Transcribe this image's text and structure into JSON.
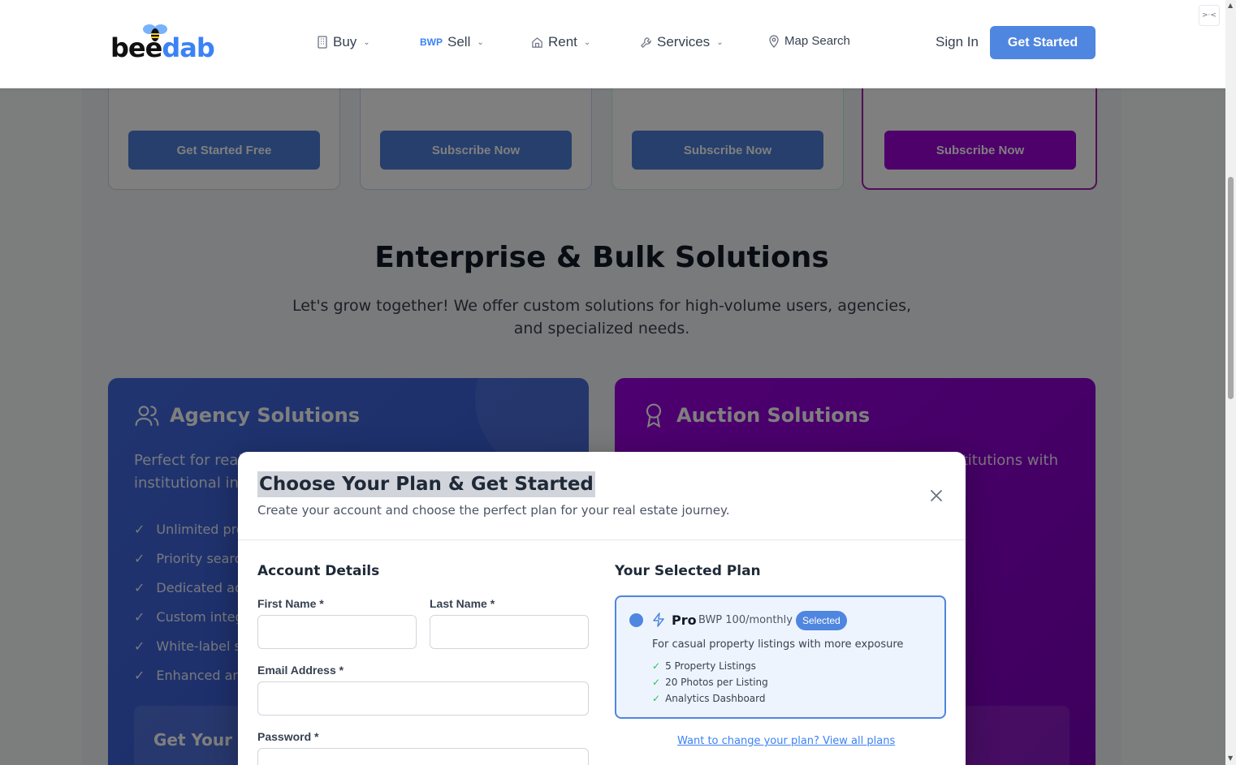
{
  "header": {
    "logo": {
      "part1": "bee",
      "part2": "dab"
    },
    "nav": [
      {
        "label": "Buy",
        "icon": "building-icon"
      },
      {
        "label": "Sell",
        "prefix": "BWP"
      },
      {
        "label": "Rent",
        "icon": "home-icon"
      },
      {
        "label": "Services",
        "icon": "wrench-icon"
      },
      {
        "label": "Map Search",
        "icon": "map-pin-icon"
      }
    ],
    "sign_in": "Sign In",
    "get_started": "Get Started"
  },
  "plans": [
    {
      "button": "Get Started Free"
    },
    {
      "button": "Subscribe Now"
    },
    {
      "button": "Subscribe Now"
    },
    {
      "button": "Subscribe Now"
    }
  ],
  "enterprise": {
    "title": "Enterprise & Bulk Solutions",
    "subtitle": "Let's grow together! We offer custom solutions for high-volume users, agencies, and specialized needs."
  },
  "agency": {
    "title": "Agency Solutions",
    "desc": "Perfect for real e\ninstitutional inve",
    "features": [
      "Unlimited pro",
      "Priority search",
      "Dedicated acc",
      "Custom integ",
      "White-label so",
      "Enhanced ana"
    ],
    "cta": "Get Your Cu"
  },
  "auction": {
    "title": "Auction Solutions",
    "desc": "stitutions with"
  },
  "modal": {
    "title": "Choose Your Plan & Get Started",
    "subtitle": "Create your account and choose the perfect plan for your real estate journey.",
    "account": {
      "heading": "Account Details",
      "first_name": "First Name *",
      "last_name": "Last Name *",
      "email": "Email Address *",
      "password": "Password *"
    },
    "plan": {
      "heading": "Your Selected Plan",
      "name": "Pro",
      "price": "BWP 100/monthly",
      "badge": "Selected",
      "desc": "For casual property listings with more exposure",
      "features": [
        "5 Property Listings",
        "20 Photos per Listing",
        "Analytics Dashboard"
      ],
      "change_link": "Want to change your plan? View all plans"
    }
  },
  "colors": {
    "primary": "#4f86e0",
    "purple": "#9d00d6",
    "agency_bg": "#4169e1",
    "auction_bg": "#9b00e0"
  }
}
